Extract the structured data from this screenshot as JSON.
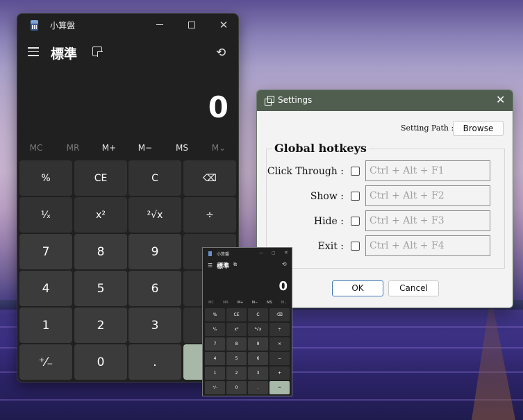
{
  "calculator": {
    "window_title": "小算盤",
    "mode_title": "標準",
    "display_value": "0",
    "memory_buttons": [
      {
        "label": "MC",
        "enabled": false
      },
      {
        "label": "MR",
        "enabled": false
      },
      {
        "label": "M+",
        "enabled": true
      },
      {
        "label": "M−",
        "enabled": true
      },
      {
        "label": "MS",
        "enabled": true
      },
      {
        "label": "M⌄",
        "enabled": false
      }
    ],
    "keys": [
      [
        "%",
        "CE",
        "C",
        "⌫"
      ],
      [
        "¹⁄ₓ",
        "x²",
        "²√x",
        "÷"
      ],
      [
        "7",
        "8",
        "9",
        "×"
      ],
      [
        "4",
        "5",
        "6",
        "−"
      ],
      [
        "1",
        "2",
        "3",
        "+"
      ],
      [
        "⁺⁄₋",
        "0",
        ".",
        "="
      ]
    ],
    "icons": {
      "app": "calculator-icon",
      "menu": "hamburger-icon",
      "keep_on_top": "keep-on-top-icon",
      "history": "history-icon"
    },
    "accent_color": "#a8b8a8"
  },
  "settings_dialog": {
    "title": "Settings",
    "setting_path_label": "Setting Path :",
    "browse_label": "Browse",
    "group_title": "Global hotkeys",
    "hotkeys": [
      {
        "label": "Click Through :",
        "checked": false,
        "placeholder": "Ctrl + Alt + F1"
      },
      {
        "label": "Show :",
        "checked": false,
        "placeholder": "Ctrl + Alt + F2"
      },
      {
        "label": "Hide :",
        "checked": false,
        "placeholder": "Ctrl + Alt + F3"
      },
      {
        "label": "Exit :",
        "checked": false,
        "placeholder": "Ctrl + Alt + F4"
      }
    ],
    "ok_label": "OK",
    "cancel_label": "Cancel",
    "title_bar_color": "#505e50"
  },
  "mini_calculator": {
    "window_title": "小算盤",
    "mode_title": "標準",
    "display_value": "0"
  }
}
